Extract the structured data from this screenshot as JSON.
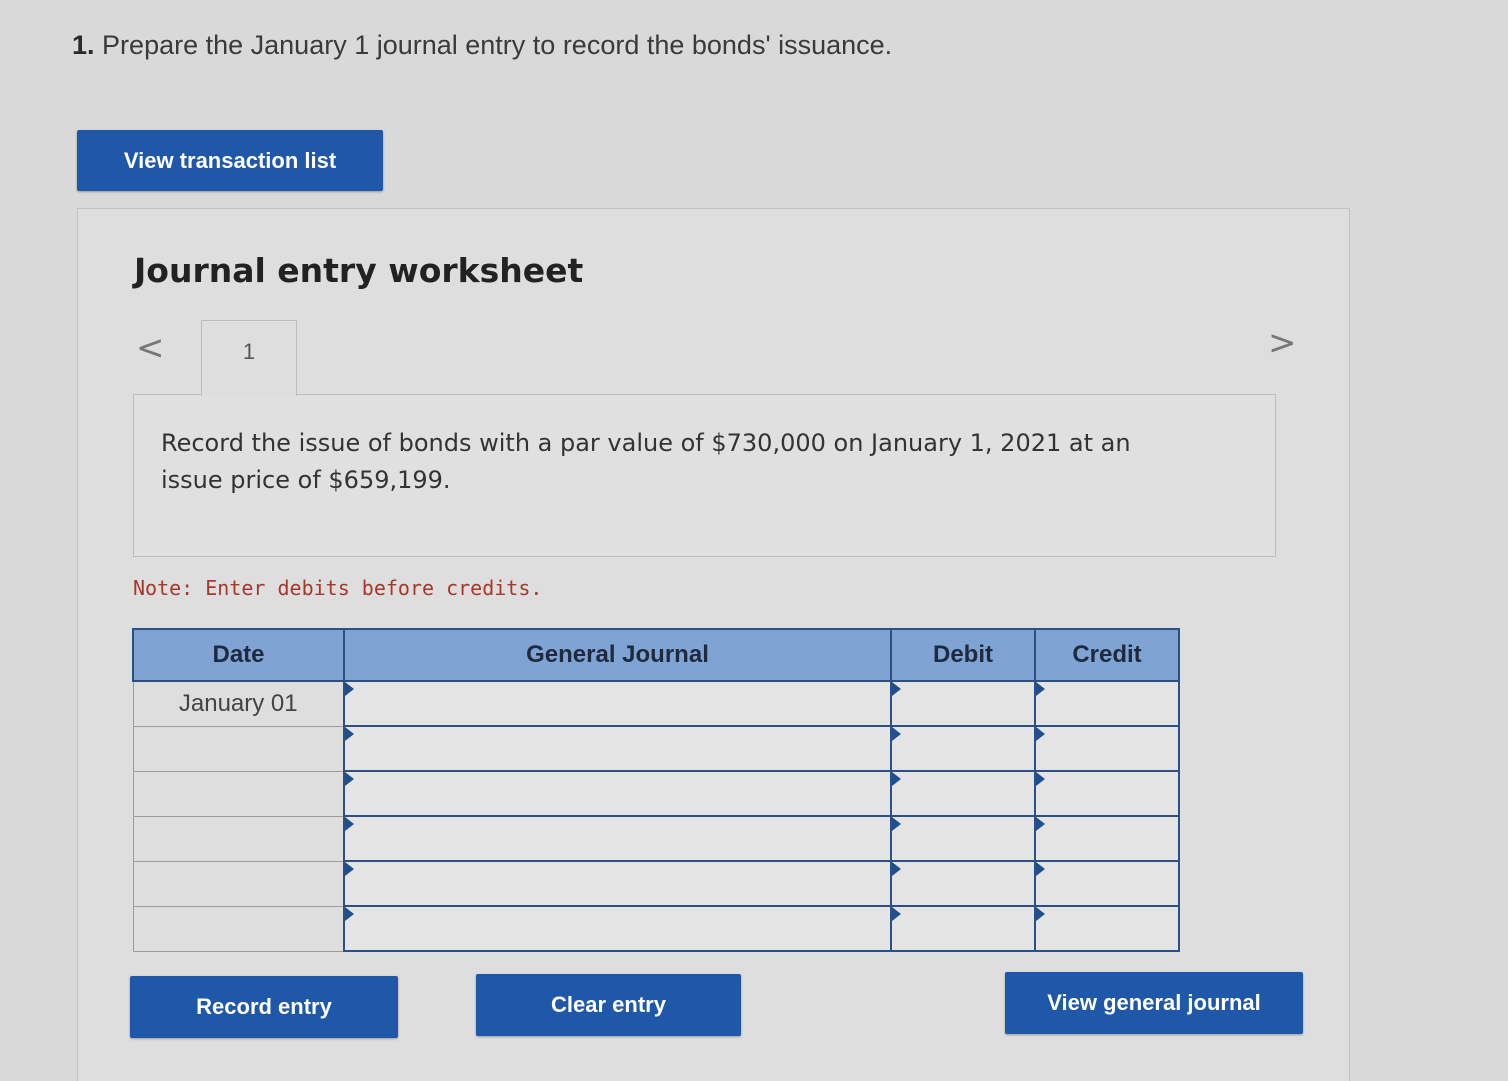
{
  "question": {
    "number": "1.",
    "text": "Prepare the January 1 journal entry to record the bonds' issuance."
  },
  "buttons": {
    "view_transaction_list": "View transaction list",
    "record_entry": "Record entry",
    "clear_entry": "Clear entry",
    "view_general_journal": "View general journal"
  },
  "worksheet": {
    "title": "Journal entry worksheet",
    "prev_arrow": "<",
    "next_arrow": ">",
    "active_tab": "1",
    "description": "Record the issue of bonds with a par value of $730,000 on January 1, 2021 at an issue price of $659,199.",
    "note": "Note: Enter debits before credits."
  },
  "journal": {
    "headers": {
      "date": "Date",
      "general_journal": "General Journal",
      "debit": "Debit",
      "credit": "Credit"
    },
    "rows": [
      {
        "date": "January 01",
        "account": "",
        "debit": "",
        "credit": ""
      },
      {
        "date": "",
        "account": "",
        "debit": "",
        "credit": ""
      },
      {
        "date": "",
        "account": "",
        "debit": "",
        "credit": ""
      },
      {
        "date": "",
        "account": "",
        "debit": "",
        "credit": ""
      },
      {
        "date": "",
        "account": "",
        "debit": "",
        "credit": ""
      },
      {
        "date": "",
        "account": "",
        "debit": "",
        "credit": ""
      }
    ]
  },
  "colors": {
    "button_bg": "#1f58a8",
    "table_header_bg": "#7fa4d3",
    "table_border": "#2c4f84",
    "note_text": "#a6372a"
  }
}
